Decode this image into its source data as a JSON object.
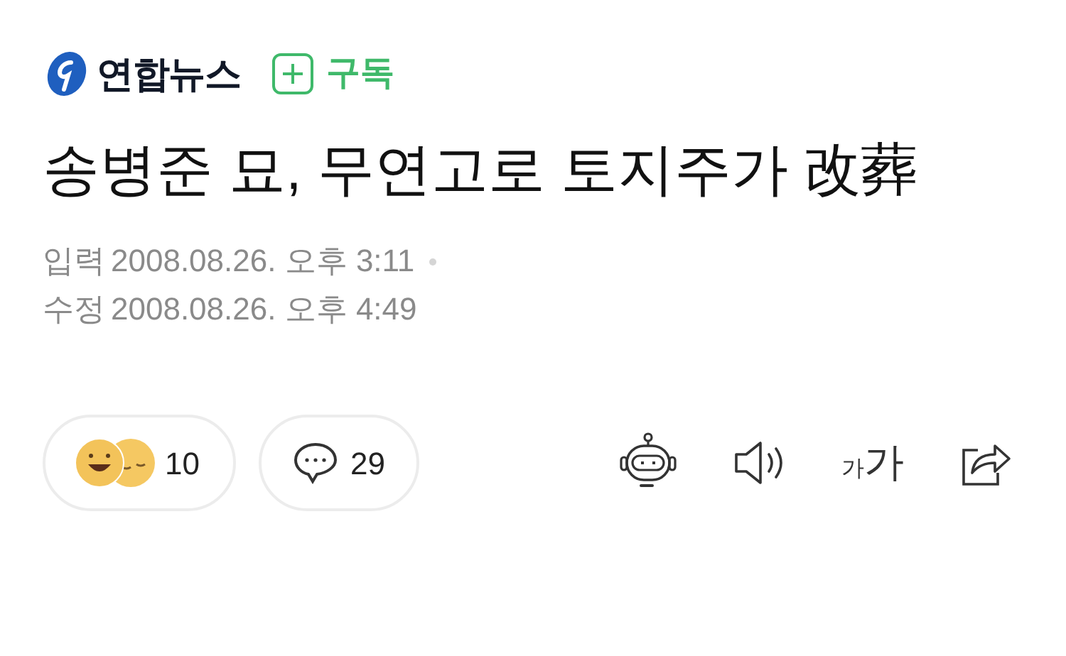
{
  "press": {
    "name": "연합뉴스"
  },
  "subscribe": {
    "label": "구독"
  },
  "headline": "송병준 묘, 무연고로 토지주가 改葬",
  "timestamps": [
    {
      "label": "입력",
      "value": "2008.08.26. 오후 3:11"
    },
    {
      "label": "수정",
      "value": "2008.08.26. 오후 4:49"
    }
  ],
  "reactions": {
    "count": "10"
  },
  "comments": {
    "count": "29"
  },
  "font_size_button": {
    "small": "가",
    "large": "가"
  }
}
